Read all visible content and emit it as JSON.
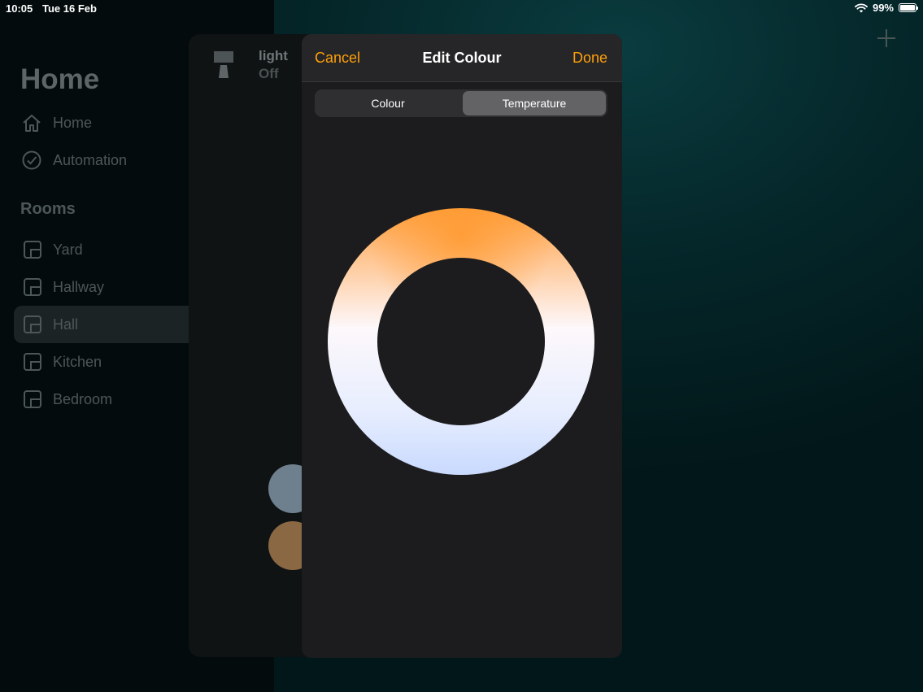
{
  "status": {
    "time": "10:05",
    "date": "Tue 16 Feb",
    "battery": "99%",
    "battery_level": 0.99
  },
  "sidebar": {
    "title": "Home",
    "nav": [
      {
        "label": "Home",
        "icon": "house-icon"
      },
      {
        "label": "Automation",
        "icon": "clock-check-icon"
      }
    ],
    "rooms_header": "Rooms",
    "rooms": [
      {
        "label": "Yard",
        "selected": false
      },
      {
        "label": "Hallway",
        "selected": false
      },
      {
        "label": "Hall",
        "selected": true
      },
      {
        "label": "Kitchen",
        "selected": false
      },
      {
        "label": "Bedroom",
        "selected": false
      }
    ]
  },
  "accessory": {
    "name": "light",
    "state": "Off"
  },
  "modal": {
    "cancel": "Cancel",
    "title": "Edit Colour",
    "done": "Done",
    "segments": [
      {
        "label": "Colour",
        "active": false
      },
      {
        "label": "Temperature",
        "active": true
      }
    ]
  },
  "colors": {
    "accent": "#ff9f0a",
    "warm": "#ff9e3b",
    "neutral": "#fdf8fb",
    "cool": "#c9dafe",
    "swatch_cool": "#6e7f8e",
    "swatch_warm": "#8a6843"
  }
}
